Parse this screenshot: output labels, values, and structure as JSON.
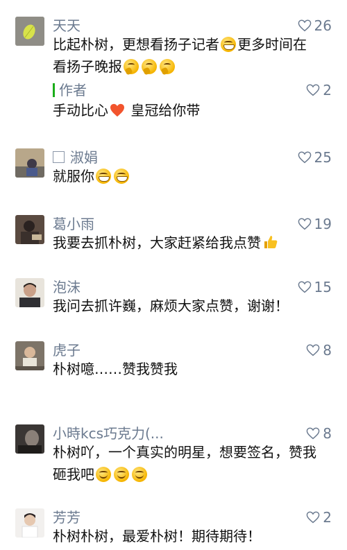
{
  "colors": {
    "name": "#6b7a8f",
    "text": "#111111",
    "reply_bar": "#1aad19"
  },
  "comments": [
    {
      "name": "天天",
      "likes": "26",
      "line1": "比起朴树，更想看扬子记者",
      "line1b": "更多时间在",
      "line2": "看扬子晚报",
      "emojis": [
        "grin-face",
        "thinking-face",
        "thinking-face",
        "thinking-face"
      ],
      "reply": {
        "name": "作者",
        "likes": "2",
        "text": "手动比心",
        "text_after": " 皇冠给你带",
        "emoji": "heart"
      }
    },
    {
      "name": "淑娟",
      "likes": "25",
      "text": "就服你",
      "emojis": [
        "grin-face",
        "grin-face"
      ]
    },
    {
      "name": "葛小雨",
      "likes": "19",
      "text": "我要去抓朴树，大家赶紧给我点赞",
      "emojis": [
        "thumbs-up"
      ]
    },
    {
      "name": "泡沫",
      "likes": "15",
      "text": "我问去抓许巍，麻烦大家点赞，谢谢！"
    },
    {
      "name": "虎子",
      "likes": "8",
      "text": "朴树噫……赞我赞我"
    },
    {
      "name": "小時kcs巧克力(...",
      "likes": "8",
      "line1": "朴树吖，一个真实的明星，想要签名，赞我",
      "line2": "砸我吧",
      "emojis": [
        "smile-face",
        "smile-face",
        "smile-face"
      ]
    },
    {
      "name": "芳芳",
      "likes": "2",
      "text": "朴树朴树，最爱朴树！期待期待！"
    }
  ]
}
